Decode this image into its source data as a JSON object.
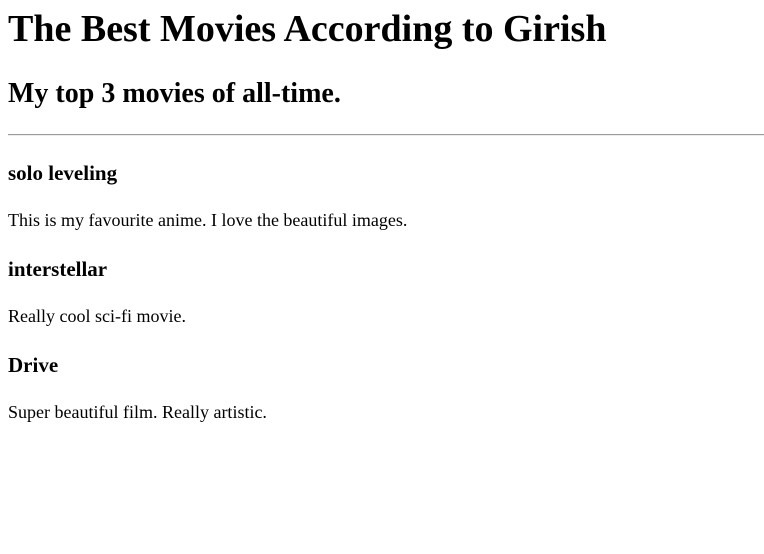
{
  "header": {
    "title": "The Best Movies According to Girish",
    "subtitle": "My top 3 movies of all-time."
  },
  "movies": [
    {
      "title": "solo leveling",
      "description": "This is my favourite anime. I love the beautiful images."
    },
    {
      "title": "interstellar",
      "description": "Really cool sci-fi movie."
    },
    {
      "title": "Drive",
      "description": "Super beautiful film. Really artistic."
    }
  ]
}
